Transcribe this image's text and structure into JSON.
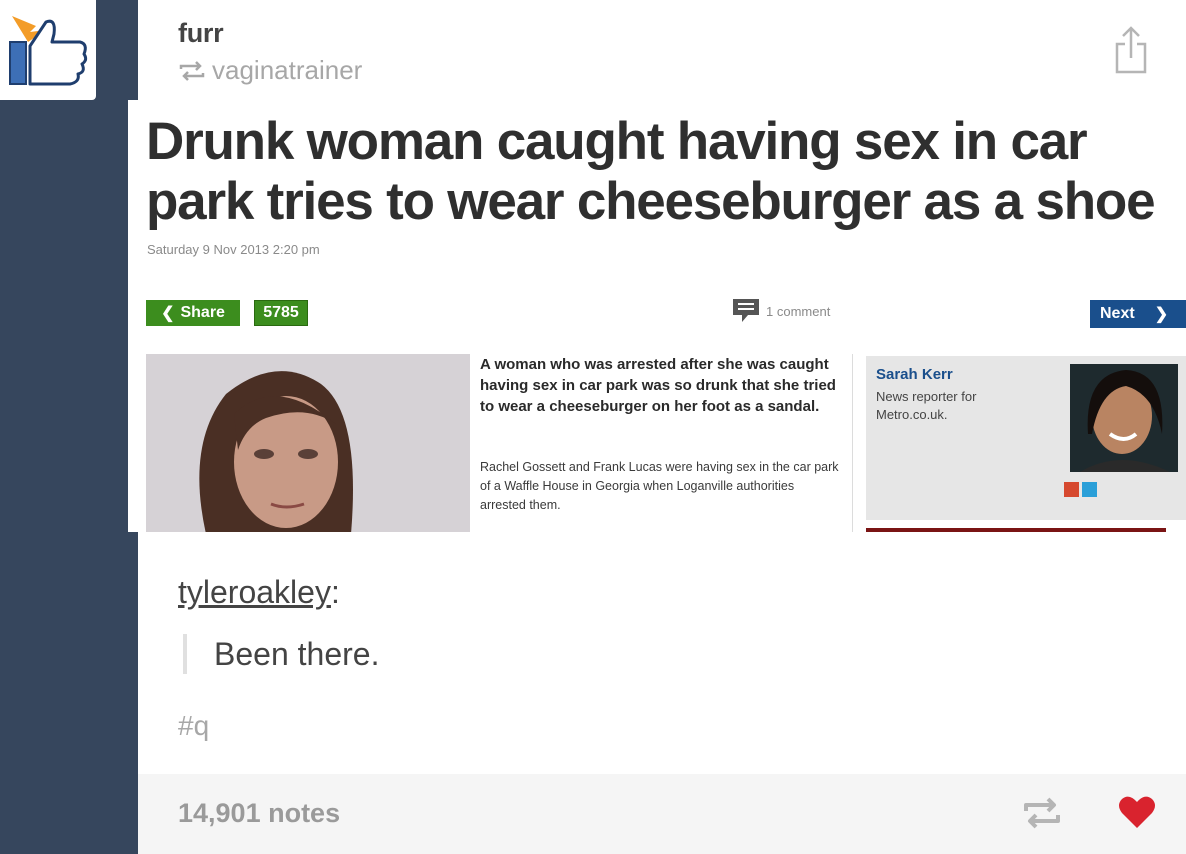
{
  "post": {
    "author": "furr",
    "reblogged_from": "vaginatrainer"
  },
  "article": {
    "headline": "Drunk woman caught having sex in car park tries to wear cheeseburger as a shoe",
    "date": "Saturday 9 Nov 2013 2:20 pm",
    "share_label": "Share",
    "share_count": "5785",
    "comment_label": "1 comment",
    "next_label": "Next",
    "lead": "A woman who was arrested after she was caught having sex in car park was so drunk that she tried to wear a cheeseburger on her foot as a sandal.",
    "body": "Rachel Gossett and Frank Lucas were having sex in the car park of a Waffle House in Georgia when Loganville authorities arrested them.",
    "author_name": "Sarah Kerr",
    "author_role": "News reporter for Metro.co.uk."
  },
  "comment": {
    "user": "tyleroakley",
    "separator": ":",
    "text": "Been there."
  },
  "tags": [
    "#q"
  ],
  "footer": {
    "notes": "14,901 notes"
  },
  "colors": {
    "background": "#36465d",
    "share_green": "#3c8d1e",
    "next_blue": "#1a4f8c",
    "heart": "#d9232e"
  },
  "icons": [
    "thumbs-up-icon",
    "reblog-icon",
    "share-icon",
    "heart-icon",
    "comment-icon"
  ]
}
